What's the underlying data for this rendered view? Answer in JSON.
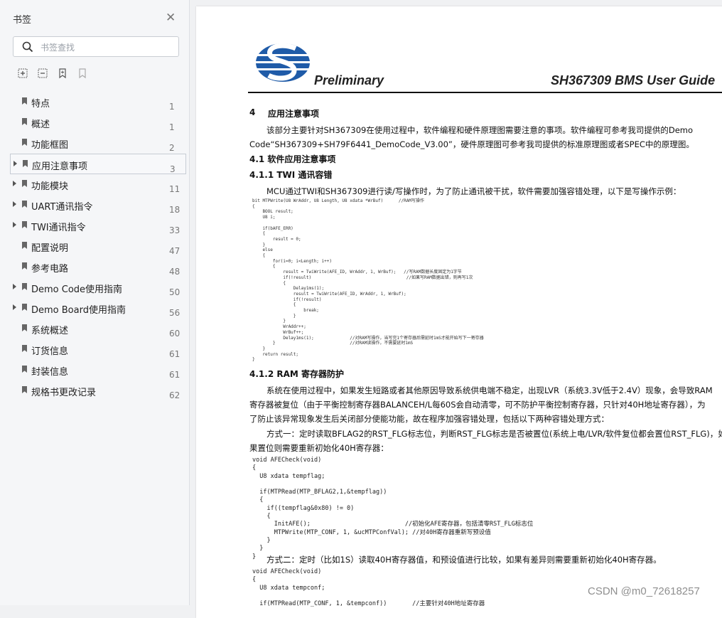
{
  "sidebar": {
    "title": "书签",
    "close_icon": "close-icon",
    "search_placeholder": "书签查找",
    "tools": [
      "expand-all-icon",
      "collapse-all-icon",
      "add-bookmark-icon",
      "bookmark-outline-icon"
    ],
    "items": [
      {
        "label": "特点",
        "page": "1",
        "expandable": false
      },
      {
        "label": "概述",
        "page": "1",
        "expandable": false
      },
      {
        "label": "功能框图",
        "page": "2",
        "expandable": false
      },
      {
        "label": "应用注意事项",
        "page": "3",
        "expandable": true,
        "selected": true
      },
      {
        "label": "功能模块",
        "page": "11",
        "expandable": true
      },
      {
        "label": "UART通讯指令",
        "page": "18",
        "expandable": true
      },
      {
        "label": "TWI通讯指令",
        "page": "33",
        "expandable": true
      },
      {
        "label": "配置说明",
        "page": "47",
        "expandable": false
      },
      {
        "label": "参考电路",
        "page": "48",
        "expandable": false
      },
      {
        "label": "Demo Code使用指南",
        "page": "50",
        "expandable": true
      },
      {
        "label": "Demo Board使用指南",
        "page": "56",
        "expandable": true
      },
      {
        "label": "系统概述",
        "page": "60",
        "expandable": false
      },
      {
        "label": "订货信息",
        "page": "61",
        "expandable": false
      },
      {
        "label": "封装信息",
        "page": "61",
        "expandable": false
      },
      {
        "label": "规格书更改记录",
        "page": "62",
        "expandable": false
      }
    ]
  },
  "document": {
    "header_left": "Preliminary",
    "header_right": "SH367309 BMS User Guide",
    "sec4_num": "4",
    "sec4_title": "应用注意事项",
    "para1_line1": "该部分主要针对SH367309在使用过程中，软件编程和硬件原理图需要注意的事项。软件编程可参考我司提供的Demo",
    "para1_line2": "Code“SH367309+SH79F6441_DemoCode_V3.00”，硬件原理图可参考我司提供的标准原理图或者SPEC中的原理图。",
    "sec41": "4.1   软件应用注意事项",
    "sec411": "4.1.1  TWI 通讯容错",
    "para2": "MCU通过TWI和SH367309进行读/写操作时，为了防止通讯被干扰，软件需要加强容错处理，以下是写操作示例：",
    "code1": "bit MTPWrite(U8 WrAddr, U8 Length, U8 xdata *WrBuf)      //RAM写操作\n{\n    BOOL result;\n    U8 i;\n\n    if(bAFE_ERR)\n    {\n        result = 0;\n    }\n    else\n    {\n        for(i=0; i<Length; i++)\n        {\n            result = TwiWrite(AFE_ID, WrAddr, 1, WrBuf);   //写RAM数据长度固定为1字节\n            if(!result)                                     //如果写RAM数据出错，则再写1次\n            {\n                Delay1ms(1);\n                result = TwiWrite(AFE_ID, WrAddr, 1, WrBuf);\n                if(!result)\n                {\n                    break;\n                }\n            }\n            WrAddr++;\n            WrBuf++;\n            Delay1ms(1);              //对RAM写操作，当写完1个寄存器后需延时1mS才能开始写下一寄存器\n        }                             //对RAM读操作，不需要延时1mS\n    }\n    return result;\n}",
    "sec412": "4.1.2  RAM 寄存器防护",
    "para3_line1": "系统在使用过程中，如果发生短路或者其他原因导致系统供电端不稳定，出现LVR（系统3.3V低于2.4V）现象，会导致RAM",
    "para3_line2": "寄存器被复位（由于平衡控制寄存器BALANCEH/L每60S会自动清零，可不防护平衡控制寄存器，只针对40H地址寄存器），为",
    "para3_line3": "了防止该异常现象发生后关闭部分使能功能，故在程序加强容错处理，包括以下两种容错处理方式：",
    "para4_line1": "方式一：定时读取BFLAG2的RST_FLG标志位，判断RST_FLG标志是否被置位(系统上电/LVR/软件复位都会置位RST_FLG)，如",
    "para4_line2": "果置位则需要重新初始化40H寄存器：",
    "code2": "void AFECheck(void)\n{\n  U8 xdata tempflag;\n\n  if(MTPRead(MTP_BFLAG2,1,&tempflag))\n  {\n    if((tempflag&0x80) != 0)\n    {\n      InitAFE();                          //初始化AFE寄存器，包括清零RST_FLG标志位\n      MTPWrite(MTP_CONF, 1, &ucMTPConfVal); //对40H寄存器重新写预设值\n    }\n  }\n}",
    "para5": "方式二：定时（比如1S）读取40H寄存器值，和预设值进行比较，如果有差异则需要重新初始化40H寄存器。",
    "code3": "void AFECheck(void)\n{\n  U8 xdata tempconf;\n\n  if(MTPRead(MTP_CONF, 1, &tempconf))       //主要针对40H地址寄存器"
  },
  "watermark": "CSDN @m0_72618257",
  "colors": {
    "logo": "#1f5ba8",
    "keyword": "#1a1aa6",
    "comment": "#2a8a8a"
  }
}
